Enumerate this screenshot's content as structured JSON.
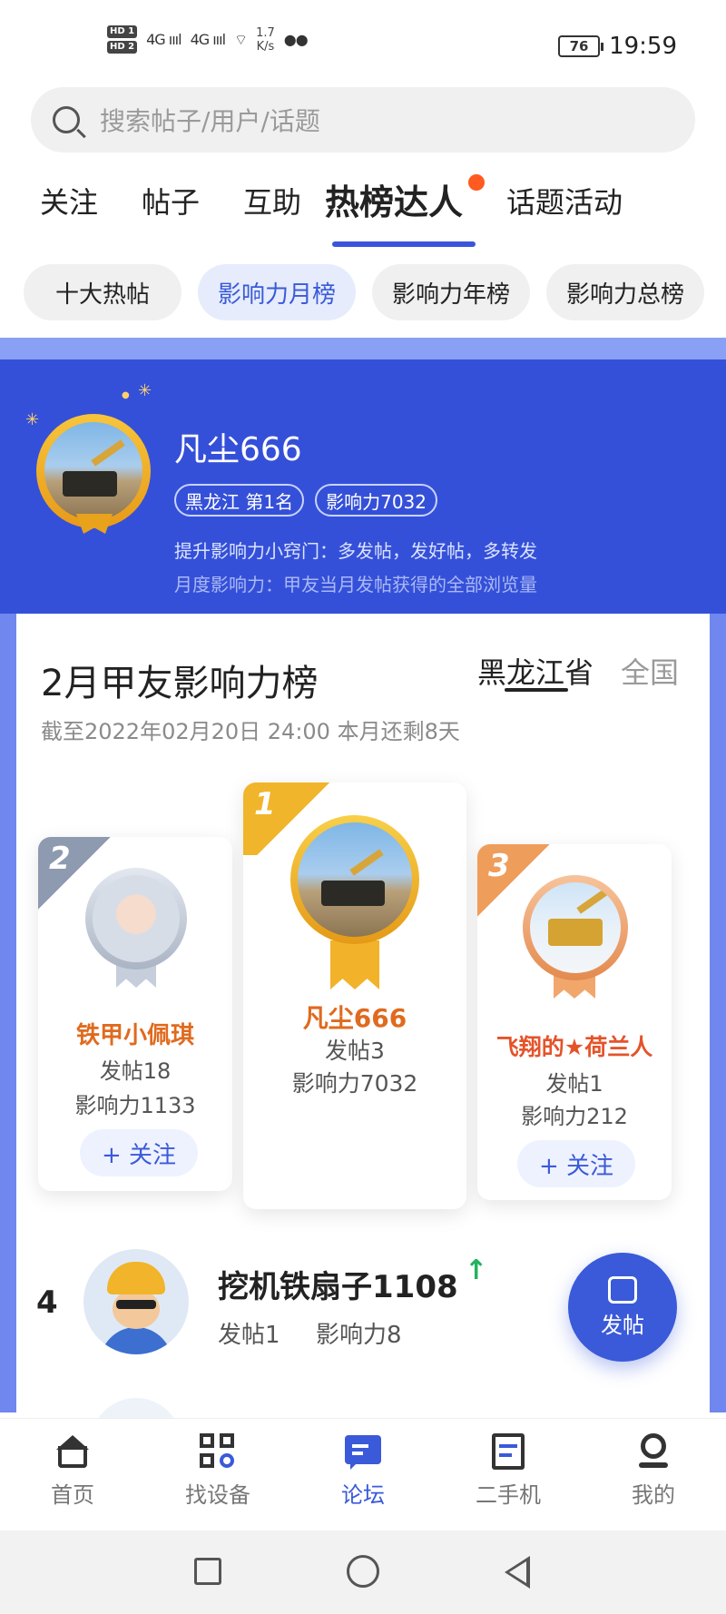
{
  "status_bar": {
    "hd1": "HD 1",
    "hd2": "HD 2",
    "signal1": "4G ıııl",
    "signal2": "4G ıııl",
    "speed_value": "1.7",
    "speed_unit": "K/s",
    "battery": "76",
    "time": "19:59"
  },
  "search": {
    "placeholder": "搜索帖子/用户/话题"
  },
  "tabs": [
    {
      "label": "关注"
    },
    {
      "label": "帖子"
    },
    {
      "label": "互助"
    },
    {
      "label": "热榜达人",
      "active": true
    },
    {
      "label": "话题活动"
    }
  ],
  "subtabs": [
    {
      "label": "十大热帖"
    },
    {
      "label": "影响力月榜",
      "active": true
    },
    {
      "label": "影响力年榜"
    },
    {
      "label": "影响力总榜"
    }
  ],
  "hero": {
    "name": "凡尘666",
    "tag_rank": "黑龙江  第1名",
    "tag_influence": "影响力7032",
    "tip1": "提升影响力小窍门：多发帖，发好帖，多转发",
    "tip2": "月度影响力：甲友当月发帖获得的全部浏览量"
  },
  "board": {
    "title": "2月甲友影响力榜",
    "region_active": "黑龙江省",
    "region_other": "全国",
    "deadline": "截至2022年02月20日 24:00 本月还剩8天"
  },
  "podium": [
    {
      "rank": "1",
      "name": "凡尘666",
      "posts": "发帖3",
      "influence": "影响力7032"
    },
    {
      "rank": "2",
      "name": "铁甲小佩琪",
      "posts": "发帖18",
      "influence": "影响力1133",
      "follow": "+ 关注"
    },
    {
      "rank": "3",
      "name": "飞翔的★荷兰人",
      "posts": "发帖1",
      "influence": "影响力212",
      "follow": "+ 关注"
    }
  ],
  "list": [
    {
      "rank": "4",
      "name": "挖机铁扇子1108",
      "trend": "↑",
      "posts": "发帖1",
      "influence": "影响力8"
    }
  ],
  "fab": {
    "label": "发帖"
  },
  "bottom_nav": [
    {
      "label": "首页",
      "icon": "home-icon"
    },
    {
      "label": "找设备",
      "icon": "grid-search-icon"
    },
    {
      "label": "论坛",
      "icon": "chat-icon",
      "active": true
    },
    {
      "label": "二手机",
      "icon": "list-icon"
    },
    {
      "label": "我的",
      "icon": "user-icon"
    }
  ],
  "colors": {
    "accent": "#3a5ad9",
    "hero_bg": "#3550d8",
    "gold": "#f0b52a",
    "silver": "#b9c3d3",
    "bronze": "#ef9d5b",
    "name_orange": "#e06a1e",
    "trend_green": "#22b35e"
  }
}
